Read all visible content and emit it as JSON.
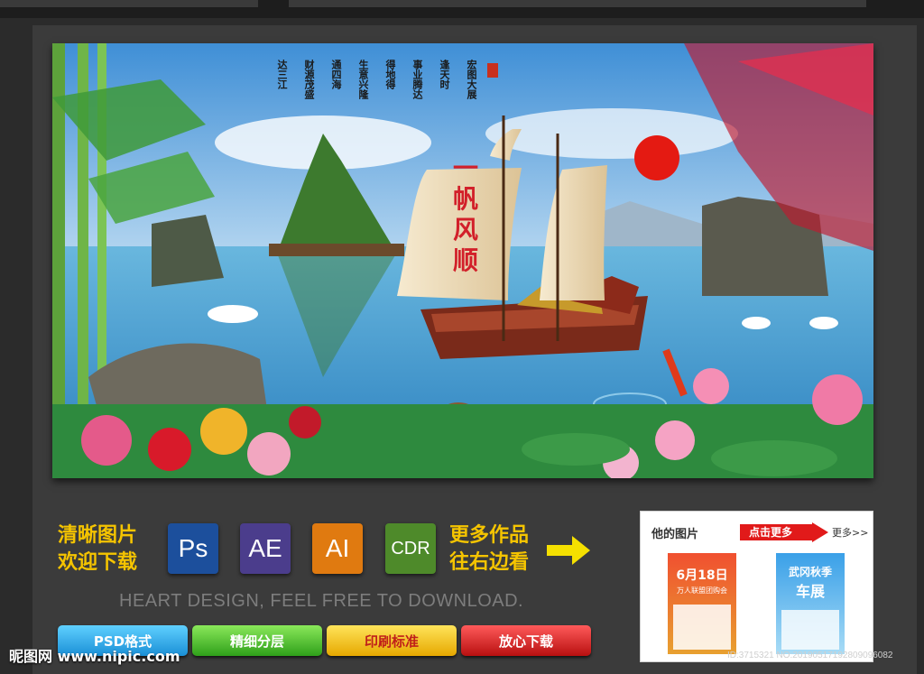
{
  "poster": {
    "sail_text": [
      "一",
      "帆",
      "风",
      "顺"
    ],
    "poem_columns": [
      "宏图大展",
      "逢天时",
      "事业腾达",
      "得地得",
      "生意兴隆",
      "通四海",
      "财源茂盛",
      "达三江"
    ]
  },
  "promo": {
    "left_line1": "清晰图片",
    "left_line2": "欢迎下载",
    "badges": [
      {
        "label": "Ps",
        "color": "#1c4f9c"
      },
      {
        "label": "AE",
        "color": "#4b3d8c"
      },
      {
        "label": "AI",
        "color": "#e07a10"
      },
      {
        "label": "CDR",
        "color": "#4e8a2a"
      }
    ],
    "right_line1": "更多作品",
    "right_line2": "往右边看",
    "slogan": "HEART DESIGN, FEEL FREE TO DOWNLOAD."
  },
  "buttons": [
    {
      "label": "PSD格式",
      "color": "#1aa7e6"
    },
    {
      "label": "精细分层",
      "color": "#3cb81c"
    },
    {
      "label": "印刷标准",
      "color": "#e8b600"
    },
    {
      "label": "放心下载",
      "color": "#d21a1a"
    }
  ],
  "sidebar": {
    "title": "他的图片",
    "more_red": "点击更多",
    "more": "更多>>",
    "thumb1": {
      "date": "6月18日",
      "line": "万人联盟团购会"
    },
    "thumb2": {
      "title": "武冈秋季",
      "subtitle": "车展"
    }
  },
  "watermark": {
    "left": "昵图网 www.nipic.com",
    "right": "ID:3715321 NO:20190517192809096082"
  },
  "colors": {
    "accent_yellow": "#f5c400",
    "background": "#2b2b2b"
  }
}
